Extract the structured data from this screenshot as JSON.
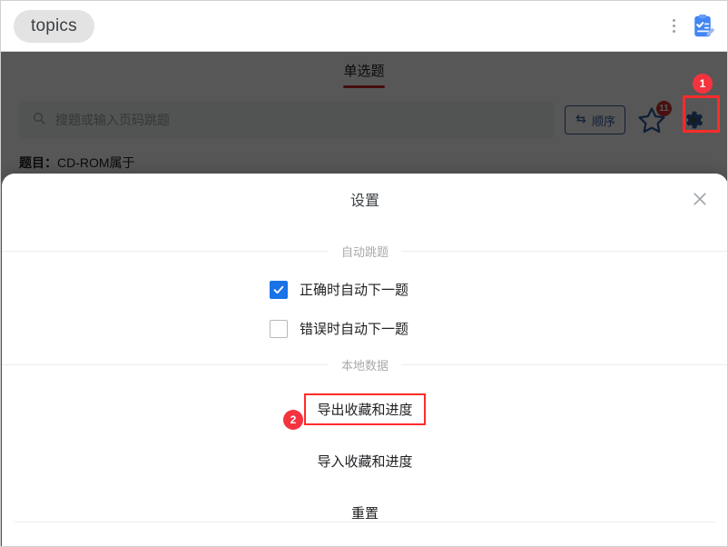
{
  "browser": {
    "tab_label": "topics",
    "menu_icon": "kebab-menu-icon",
    "extension_icon": "clipboard-checklist-icon"
  },
  "page": {
    "tabs": [
      {
        "label": "单选题",
        "active": true
      }
    ],
    "search": {
      "placeholder": "搜题或输入页码跳题",
      "value": "",
      "icon": "search-icon"
    },
    "order_button": {
      "label": "顺序",
      "icon": "swap-arrows-icon"
    },
    "favorites": {
      "icon": "star-icon",
      "badge": "11"
    },
    "settings_button": {
      "icon": "gear-icon"
    },
    "question": {
      "prefix": "题目：",
      "text": "CD-ROM属于"
    }
  },
  "modal": {
    "title": "设置",
    "close_icon": "close-icon",
    "sections": [
      {
        "label": "自动跳题",
        "options": [
          {
            "label": "正确时自动下一题",
            "checked": true
          },
          {
            "label": "错误时自动下一题",
            "checked": false
          }
        ]
      },
      {
        "label": "本地数据",
        "actions": [
          {
            "label": "导出收藏和进度",
            "highlighted": true
          },
          {
            "label": "导入收藏和进度",
            "highlighted": false
          },
          {
            "label": "重置",
            "highlighted": false
          }
        ]
      }
    ]
  },
  "annotations": [
    {
      "number": "1",
      "target": "settings-gear-button"
    },
    {
      "number": "2",
      "target": "export-favorites-button"
    }
  ],
  "colors": {
    "accent_blue": "#1a73e8",
    "tab_underline": "#c62828",
    "badge_red": "#d32f2f",
    "annotation_red": "#f5333f",
    "highlight_red": "#ff2b2b",
    "order_button_border": "#2f5d9e"
  }
}
